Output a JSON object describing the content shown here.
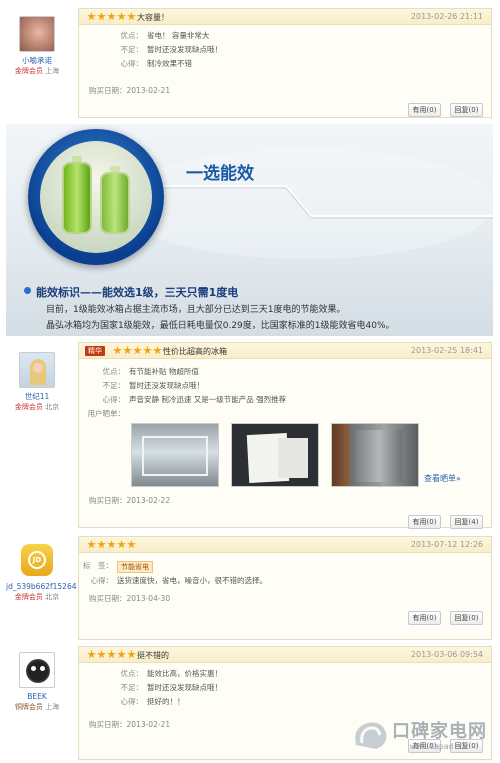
{
  "reviews": [
    {
      "user": {
        "name": "小喻承诺",
        "level": "金牌会员",
        "location": "上海"
      },
      "title": "大容量！",
      "date": "2013-02-26 21:11",
      "lines": [
        {
          "k": "优点：",
          "v": "省电！ 容量非常大"
        },
        {
          "k": "不足：",
          "v": "暂时还没发现缺点哦！"
        },
        {
          "k": "心得：",
          "v": "制冷效果不错"
        }
      ],
      "buy_date": "购买日期：2013-02-21",
      "useful": "有用(0)",
      "reply": "回复(0)"
    },
    {
      "user": {
        "name": "世纪11",
        "level": "金牌会员",
        "location": "北京"
      },
      "badge": "精华",
      "title": "性价比超高的冰箱",
      "date": "2013-02-25 18:41",
      "lines": [
        {
          "k": "优点：",
          "v": "有节能补贴 物超所值"
        },
        {
          "k": "不足：",
          "v": "暂时还没发现缺点哦！"
        },
        {
          "k": "心得：",
          "v": "声音安静 制冷迅速 又是一级节能产品 强烈推荐"
        },
        {
          "k": "用户晒单：",
          "v": ""
        }
      ],
      "more_photos": "查看晒单»",
      "buy_date": "购买日期：2013-02-22",
      "useful": "有用(0)",
      "reply": "回复(4)"
    },
    {
      "user": {
        "name": "jd_539b662f15264",
        "level": "金牌会员",
        "location": "北京"
      },
      "title": "",
      "date": "2013-07-12 12:26",
      "tag_label": "标　签：",
      "tag": "节能省电",
      "lines": [
        {
          "k": "心得：",
          "v": "送货速度快，省电，噪音小，很不错的选择。"
        }
      ],
      "buy_date": "购买日期：2013-04-30",
      "useful": "有用(0)",
      "reply": "回复(0)"
    },
    {
      "user": {
        "name": "BEEK",
        "level": "铜牌会员",
        "location": "上海"
      },
      "title": "挺不错的",
      "date": "2013-03-06 09:54",
      "lines": [
        {
          "k": "优点：",
          "v": "能效比高，价格实惠！"
        },
        {
          "k": "不足：",
          "v": "暂时还没发现缺点哦！"
        },
        {
          "k": "心得：",
          "v": "挺好的！！"
        }
      ],
      "buy_date": "购买日期：2013-02-21",
      "useful": "有用(0)",
      "reply": "回复(0)"
    }
  ],
  "banner": {
    "title": "一选能效",
    "headline": "能效标识——能效选1级，三天只需1度电",
    "body1": "目前，1级能效冰箱占据主流市场，且大部分已达到三天1度电的节能效果。",
    "body2": "晶弘冰箱均为国家1级能效，最低日耗电量仅0.29度，比国家标准的1级能效省电40%。"
  },
  "watermark": {
    "text": "口碑家电网",
    "url": "www.eapad.cn"
  },
  "colors": {
    "star": "#f2a40c",
    "link": "#2a62b0",
    "banner_title": "#1a5aa8"
  }
}
